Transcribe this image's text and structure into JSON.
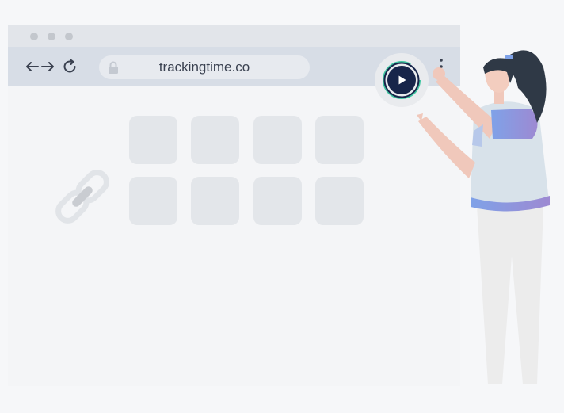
{
  "browser": {
    "url": "trackingtime.co",
    "icons": {
      "back": "arrow-left-icon",
      "forward": "arrow-right-icon",
      "reload": "reload-icon",
      "lock": "lock-icon",
      "menu": "more-vertical-icon",
      "extension": "play-icon",
      "link": "link-icon"
    },
    "tile_count": 8
  },
  "colors": {
    "accent": "#17254a",
    "ring": "#3fc7a1",
    "page_bg": "#f6f7f9",
    "toolbar": "#d7dde6"
  }
}
